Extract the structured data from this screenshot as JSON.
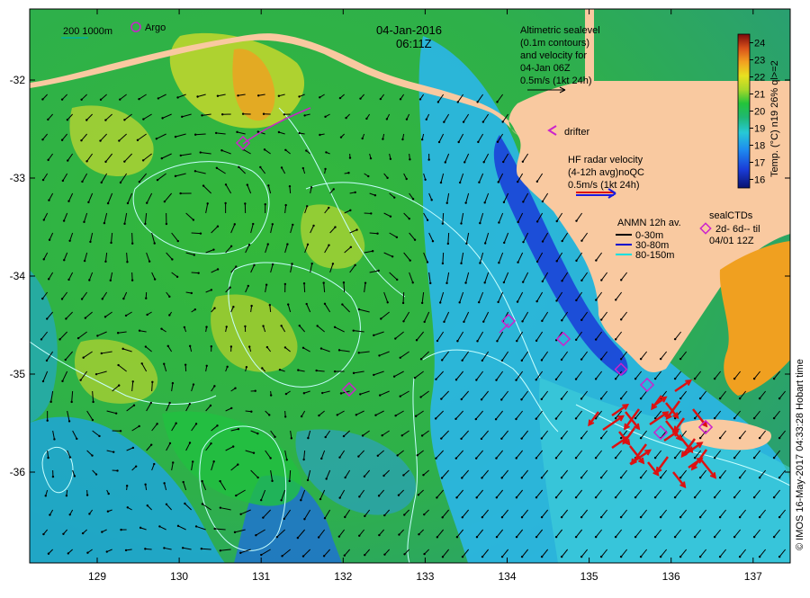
{
  "header": {
    "date": "04-Jan-2016",
    "time": "06:11Z"
  },
  "scale_label": "200  1000m",
  "argo_label": "Argo",
  "altimetry_note": [
    "Altimetric sealevel",
    "(0.1m contours)",
    "and velocity for",
    "04-Jan 06Z",
    "0.5m/s (1kt 24h)"
  ],
  "drifter_label": "drifter",
  "hf_radar_note": [
    "HF radar velocity",
    "(4-12h avg)noQC",
    "0.5m/s (1kt 24h)"
  ],
  "anmn_legend": {
    "title": "ANMN 12h av.",
    "items": [
      {
        "label": "0-30m",
        "color": "#000000"
      },
      {
        "label": "30-80m",
        "color": "#0000cc"
      },
      {
        "label": "80-150m",
        "color": "#00e0e0"
      }
    ]
  },
  "seal_legend": [
    "sealCTDs",
    "2d- 6d-- til",
    "04/01 12Z"
  ],
  "colorbar": {
    "title": "Temp. (°C) n19 26% ql>=2",
    "ticks": [
      "24",
      "23",
      "22",
      "21",
      "20",
      "19",
      "18",
      "17",
      "16"
    ],
    "min": 15.5,
    "max": 24.5
  },
  "axes": {
    "x_ticks": [
      "129",
      "130",
      "131",
      "132",
      "133",
      "134",
      "135",
      "136",
      "137"
    ],
    "y_ticks": [
      "-32",
      "-33",
      "-34",
      "-35",
      "-36"
    ]
  },
  "credit": "© IMOS 16-May-2017 04:33:28 Hobart time",
  "colors": {
    "land": "#f9c9a0",
    "hf_radar": "#dd1111",
    "argo": "#cc22cc",
    "contour": "#c8ffff"
  }
}
